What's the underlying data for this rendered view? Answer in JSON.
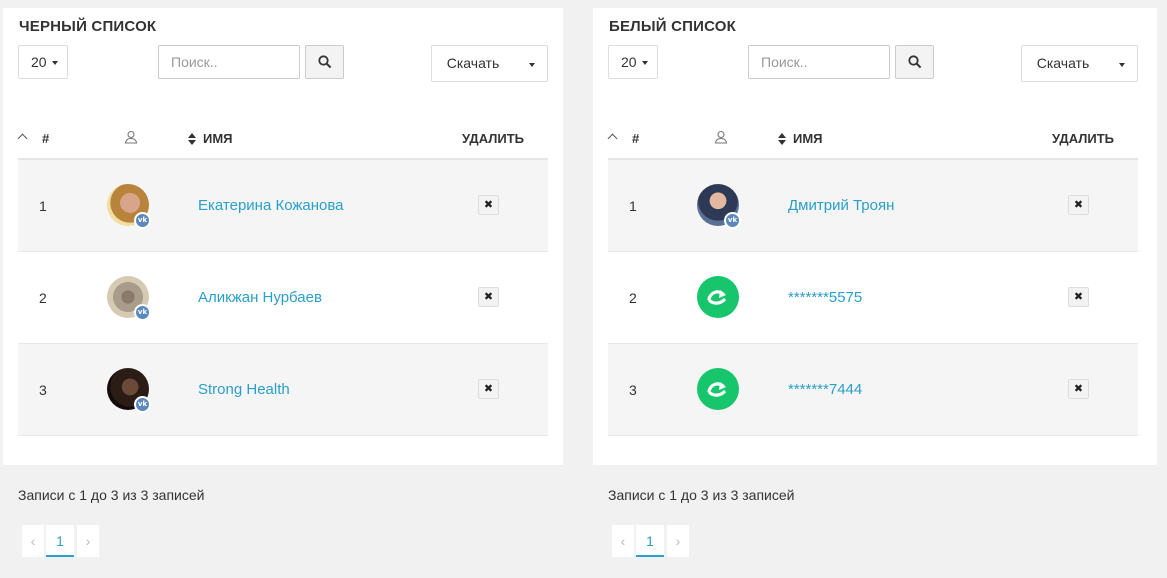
{
  "lists": [
    {
      "title": "ЧЕРНЫЙ СПИСОК",
      "page_size": "20",
      "search_placeholder": "Поиск..",
      "download_label": "Скачать",
      "columns": {
        "num": "#",
        "name": "ИМЯ",
        "delete": "УДАЛИТЬ"
      },
      "rows": [
        {
          "num": "1",
          "name": "Екатерина Кожанова",
          "avatar": "vk-photo",
          "delete": "✖"
        },
        {
          "num": "2",
          "name": "Аликжан Нурбаев",
          "avatar": "vk-photo",
          "delete": "✖"
        },
        {
          "num": "3",
          "name": "Strong Health",
          "avatar": "vk-photo",
          "delete": "✖"
        }
      ],
      "info": "Записи с 1 до 3 из 3 записей",
      "pager": {
        "prev": "‹",
        "current": "1",
        "next": "›"
      }
    },
    {
      "title": "БЕЛЫЙ СПИСОК",
      "page_size": "20",
      "search_placeholder": "Поиск..",
      "download_label": "Скачать",
      "columns": {
        "num": "#",
        "name": "ИМЯ",
        "delete": "УДАЛИТЬ"
      },
      "rows": [
        {
          "num": "1",
          "name": "Дмитрий Троян",
          "avatar": "vk-photo",
          "delete": "✖"
        },
        {
          "num": "2",
          "name": "*******5575",
          "avatar": "whatsapp-icon",
          "delete": "✖"
        },
        {
          "num": "3",
          "name": "*******7444",
          "avatar": "whatsapp-icon",
          "delete": "✖"
        }
      ],
      "info": "Записи с 1 до 3 из 3 записей",
      "pager": {
        "prev": "‹",
        "current": "1",
        "next": "›"
      }
    }
  ],
  "colors": {
    "link": "#2a9fc9",
    "vk_badge": "#5b88bd",
    "whatsapp": "#17c66c",
    "row_stripe": "#f5f5f5"
  }
}
